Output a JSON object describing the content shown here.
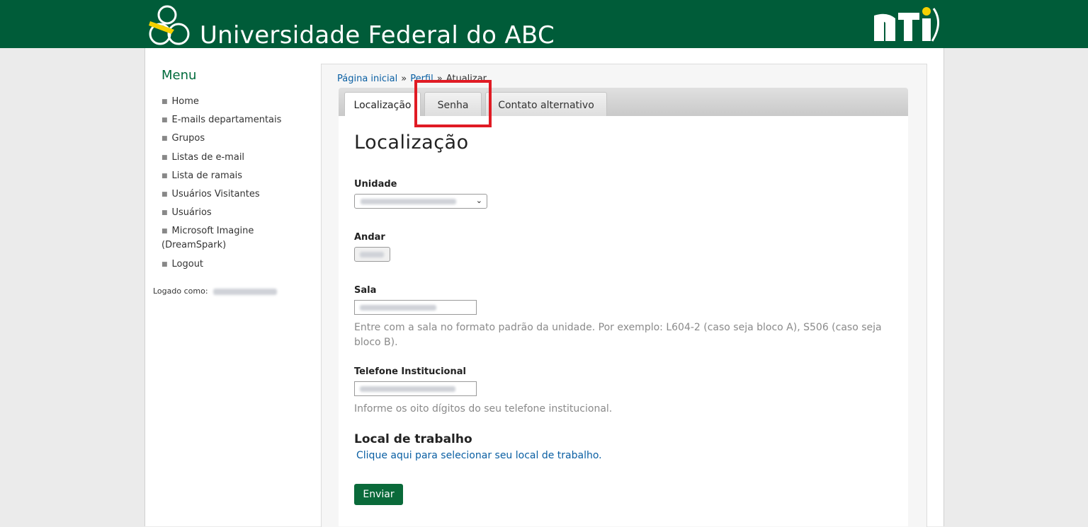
{
  "header": {
    "title": "Universidade Federal do ABC",
    "brand_color": "#005c39",
    "right_logo": "NTI"
  },
  "sidebar": {
    "title": "Menu",
    "items": [
      {
        "label": "Home"
      },
      {
        "label": "E-mails departamentais"
      },
      {
        "label": "Grupos"
      },
      {
        "label": "Listas de e-mail"
      },
      {
        "label": "Lista de ramais"
      },
      {
        "label": "Usuários Visitantes"
      },
      {
        "label": "Usuários"
      },
      {
        "label": "Microsoft Imagine (DreamSpark)"
      },
      {
        "label": "Logout"
      }
    ],
    "logged_label": "Logado como:"
  },
  "breadcrumb": {
    "items": [
      "Página inicial",
      "Perfil",
      "Atualizar"
    ],
    "separator": "»"
  },
  "tabs": [
    {
      "label": "Localização",
      "active": true
    },
    {
      "label": "Senha",
      "active": false
    },
    {
      "label": "Contato alternativo",
      "active": false
    }
  ],
  "form": {
    "title": "Localização",
    "unidade_label": "Unidade",
    "andar_label": "Andar",
    "sala_label": "Sala",
    "sala_help": "Entre com a sala no formato padrão da unidade. Por exemplo: L604-2 (caso seja bloco A), S506 (caso seja bloco B).",
    "telefone_label": "Telefone Institucional",
    "telefone_help": "Informe os oito dígitos do seu telefone institucional.",
    "local_title": "Local de trabalho",
    "local_link": "Clique aqui para selecionar seu local de trabalho.",
    "submit_label": "Enviar"
  },
  "colors": {
    "accent": "#0a6a3a",
    "link": "#0a5fa3",
    "highlight": "#e01b24"
  }
}
